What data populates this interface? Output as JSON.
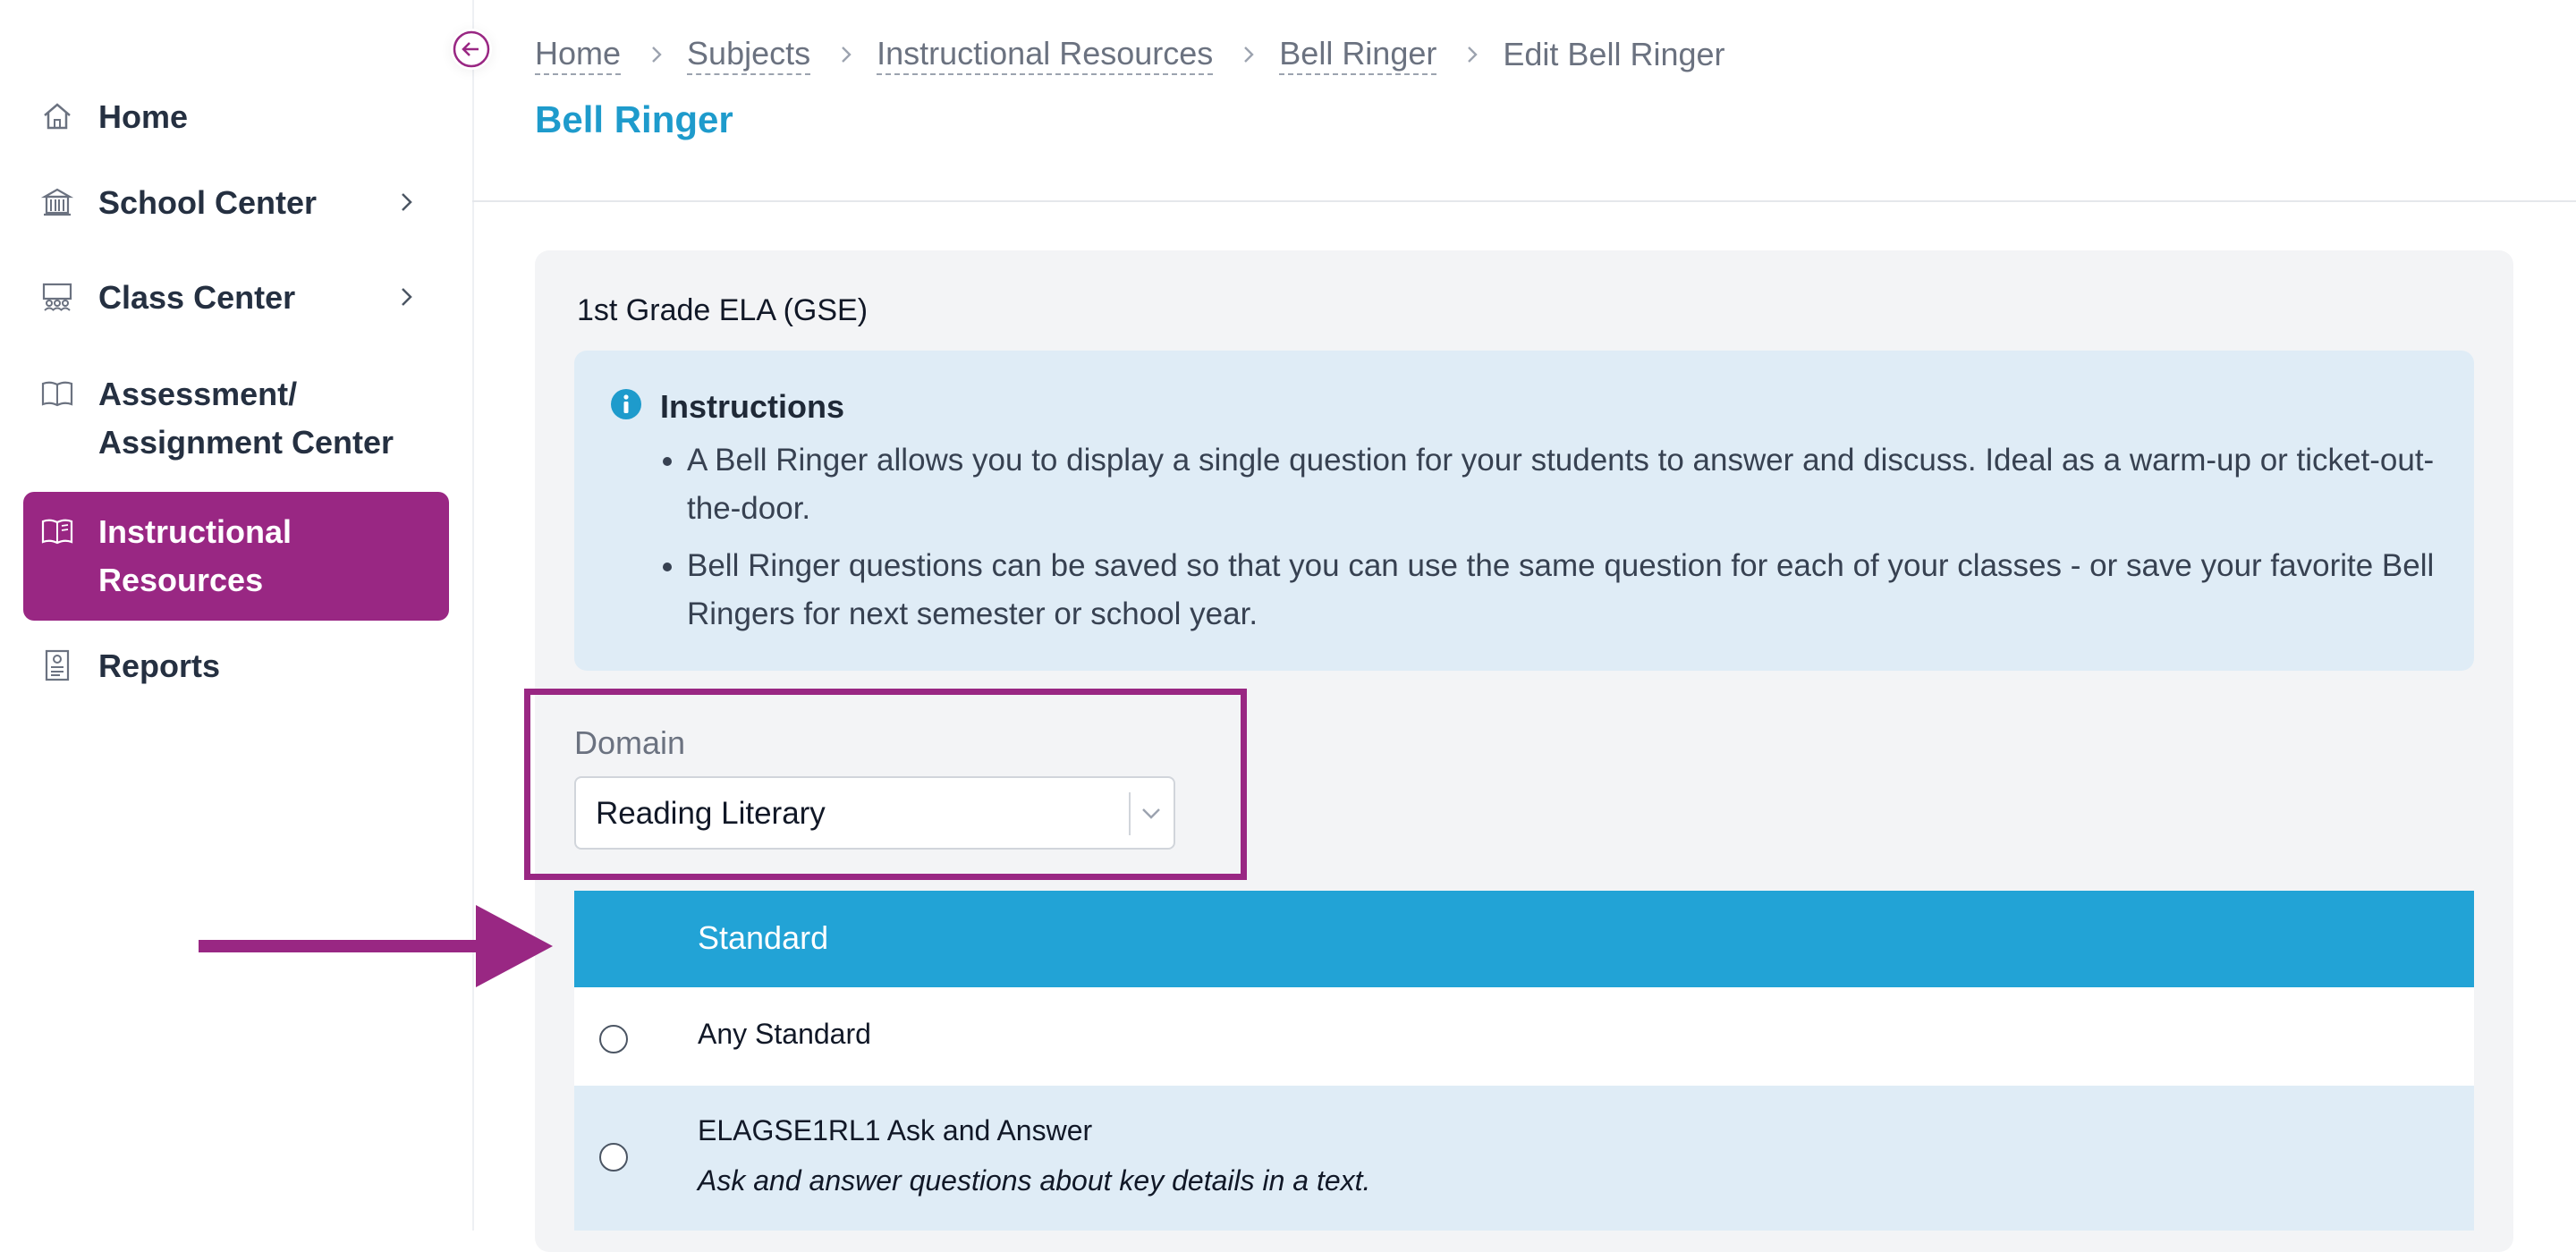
{
  "sidebar": {
    "items": [
      {
        "label": "Home",
        "icon": "home-icon",
        "has_submenu": false
      },
      {
        "label": "School Center",
        "icon": "school-icon",
        "has_submenu": true
      },
      {
        "label": "Class Center",
        "icon": "classroom-icon",
        "has_submenu": true
      },
      {
        "label": "Assessment/ Assignment Center",
        "icon": "book-open-icon",
        "has_submenu": false
      },
      {
        "label": "Instructional Resources",
        "icon": "book-open-icon",
        "has_submenu": false,
        "active": true
      },
      {
        "label": "Reports",
        "icon": "report-icon",
        "has_submenu": false
      }
    ]
  },
  "breadcrumb": [
    "Home",
    "Subjects",
    "Instructional Resources",
    "Bell Ringer",
    "Edit Bell Ringer"
  ],
  "page_title": "Bell Ringer",
  "subject": "1st Grade ELA (GSE)",
  "instructions": {
    "title": "Instructions",
    "items": [
      "A Bell Ringer allows you to display a single question for your students to answer and discuss. Ideal as a warm-up or ticket-out-the-door.",
      "Bell Ringer questions can be saved so that you can use the same question for each of your classes - or save your favorite Bell Ringers for next semester or school year."
    ]
  },
  "domain": {
    "label": "Domain",
    "value": "Reading Literary"
  },
  "standards": {
    "header": "Standard",
    "rows": [
      {
        "title": "Any Standard",
        "description": ""
      },
      {
        "title": "ELAGSE1RL1 Ask and Answer",
        "description": "Ask and answer questions about key details in a text."
      }
    ]
  },
  "colors": {
    "accent_purple": "#992783",
    "brand_blue": "#1e9bcc",
    "table_header": "#22a3d6",
    "info_bg": "#dfecf6"
  }
}
